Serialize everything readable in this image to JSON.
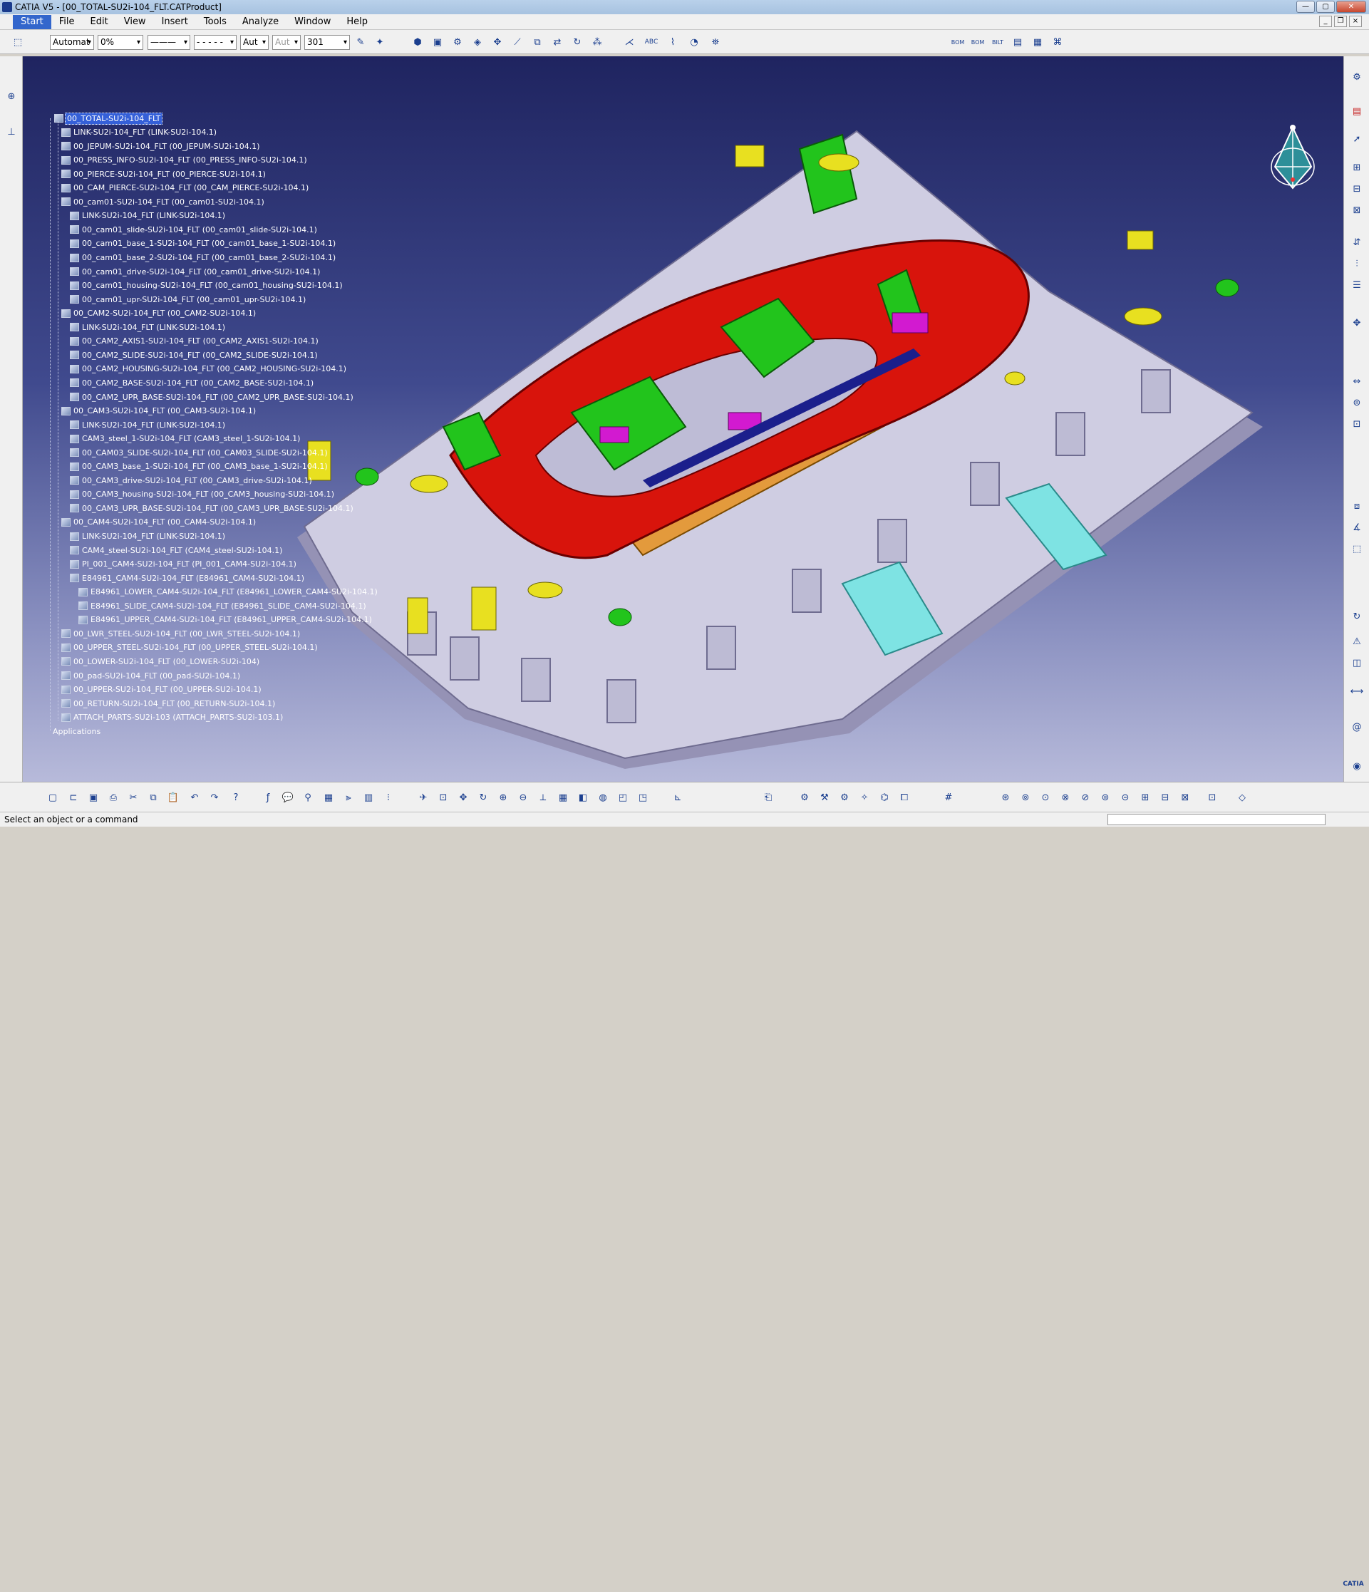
{
  "window": {
    "title": "CATIA V5 - [00_TOTAL-SU2i-104_FLT.CATProduct]",
    "controls": [
      "—",
      "▢",
      "✕"
    ]
  },
  "menu": [
    "Start",
    "File",
    "Edit",
    "View",
    "Insert",
    "Tools",
    "Analyze",
    "Window",
    "Help"
  ],
  "toolbar": {
    "selects": [
      {
        "name": "color-select",
        "value": "Automat"
      },
      {
        "name": "transparency-select",
        "value": "0%"
      },
      {
        "name": "linetype-select",
        "value": "———"
      },
      {
        "name": "linestyle-select",
        "value": "- - - - -"
      },
      {
        "name": "layer-select",
        "value": "Aut"
      },
      {
        "name": "render-select",
        "value": "Aut"
      },
      {
        "name": "weight-select",
        "value": "301"
      }
    ],
    "bom_labels": [
      "BOM",
      "BOM",
      "BILT"
    ]
  },
  "tree": [
    {
      "label": "00_TOTAL-SU2i-104_FLT",
      "level": 0,
      "root": true
    },
    {
      "label": "LINK-SU2i-104_FLT (LINK-SU2i-104.1)",
      "level": 1
    },
    {
      "label": "00_JEPUM-SU2i-104_FLT (00_JEPUM-SU2i-104.1)",
      "level": 1
    },
    {
      "label": "00_PRESS_INFO-SU2i-104_FLT (00_PRESS_INFO-SU2i-104.1)",
      "level": 1
    },
    {
      "label": "00_PIERCE-SU2i-104_FLT (00_PIERCE-SU2i-104.1)",
      "level": 1
    },
    {
      "label": "00_CAM_PIERCE-SU2i-104_FLT (00_CAM_PIERCE-SU2i-104.1)",
      "level": 1
    },
    {
      "label": "00_cam01-SU2i-104_FLT (00_cam01-SU2i-104.1)",
      "level": 1
    },
    {
      "label": "LINK-SU2i-104_FLT (LINK-SU2i-104.1)",
      "level": 2
    },
    {
      "label": "00_cam01_slide-SU2i-104_FLT (00_cam01_slide-SU2i-104.1)",
      "level": 2
    },
    {
      "label": "00_cam01_base_1-SU2i-104_FLT (00_cam01_base_1-SU2i-104.1)",
      "level": 2
    },
    {
      "label": "00_cam01_base_2-SU2i-104_FLT (00_cam01_base_2-SU2i-104.1)",
      "level": 2
    },
    {
      "label": "00_cam01_drive-SU2i-104_FLT (00_cam01_drive-SU2i-104.1)",
      "level": 2
    },
    {
      "label": "00_cam01_housing-SU2i-104_FLT (00_cam01_housing-SU2i-104.1)",
      "level": 2
    },
    {
      "label": "00_cam01_upr-SU2i-104_FLT (00_cam01_upr-SU2i-104.1)",
      "level": 2
    },
    {
      "label": "00_CAM2-SU2i-104_FLT (00_CAM2-SU2i-104.1)",
      "level": 1
    },
    {
      "label": "LINK-SU2i-104_FLT (LINK-SU2i-104.1)",
      "level": 2
    },
    {
      "label": "00_CAM2_AXIS1-SU2i-104_FLT (00_CAM2_AXIS1-SU2i-104.1)",
      "level": 2
    },
    {
      "label": "00_CAM2_SLIDE-SU2i-104_FLT (00_CAM2_SLIDE-SU2i-104.1)",
      "level": 2
    },
    {
      "label": "00_CAM2_HOUSING-SU2i-104_FLT (00_CAM2_HOUSING-SU2i-104.1)",
      "level": 2
    },
    {
      "label": "00_CAM2_BASE-SU2i-104_FLT (00_CAM2_BASE-SU2i-104.1)",
      "level": 2
    },
    {
      "label": "00_CAM2_UPR_BASE-SU2i-104_FLT (00_CAM2_UPR_BASE-SU2i-104.1)",
      "level": 2
    },
    {
      "label": "00_CAM3-SU2i-104_FLT (00_CAM3-SU2i-104.1)",
      "level": 1
    },
    {
      "label": "LINK-SU2i-104_FLT (LINK-SU2i-104.1)",
      "level": 2
    },
    {
      "label": "CAM3_steel_1-SU2i-104_FLT (CAM3_steel_1-SU2i-104.1)",
      "level": 2
    },
    {
      "label": "00_CAM03_SLIDE-SU2i-104_FLT (00_CAM03_SLIDE-SU2i-104.1)",
      "level": 2
    },
    {
      "label": "00_CAM3_base_1-SU2i-104_FLT (00_CAM3_base_1-SU2i-104.1)",
      "level": 2
    },
    {
      "label": "00_CAM3_drive-SU2i-104_FLT (00_CAM3_drive-SU2i-104.1)",
      "level": 2
    },
    {
      "label": "00_CAM3_housing-SU2i-104_FLT (00_CAM3_housing-SU2i-104.1)",
      "level": 2
    },
    {
      "label": "00_CAM3_UPR_BASE-SU2i-104_FLT (00_CAM3_UPR_BASE-SU2i-104.1)",
      "level": 2
    },
    {
      "label": "00_CAM4-SU2i-104_FLT (00_CAM4-SU2i-104.1)",
      "level": 1
    },
    {
      "label": "LINK-SU2i-104_FLT (LINK-SU2i-104.1)",
      "level": 2
    },
    {
      "label": "CAM4_steel-SU2i-104_FLT (CAM4_steel-SU2i-104.1)",
      "level": 2
    },
    {
      "label": "PI_001_CAM4-SU2i-104_FLT (PI_001_CAM4-SU2i-104.1)",
      "level": 2
    },
    {
      "label": "E84961_CAM4-SU2i-104_FLT (E84961_CAM4-SU2i-104.1)",
      "level": 2
    },
    {
      "label": "E84961_LOWER_CAM4-SU2i-104_FLT (E84961_LOWER_CAM4-SU2i-104.1)",
      "level": 3
    },
    {
      "label": "E84961_SLIDE_CAM4-SU2i-104_FLT (E84961_SLIDE_CAM4-SU2i-104.1)",
      "level": 3
    },
    {
      "label": "E84961_UPPER_CAM4-SU2i-104_FLT (E84961_UPPER_CAM4-SU2i-104.1)",
      "level": 3
    },
    {
      "label": "00_LWR_STEEL-SU2i-104_FLT (00_LWR_STEEL-SU2i-104.1)",
      "level": 1
    },
    {
      "label": "00_UPPER_STEEL-SU2i-104_FLT (00_UPPER_STEEL-SU2i-104.1)",
      "level": 1
    },
    {
      "label": "00_LOWER-SU2i-104_FLT (00_LOWER-SU2i-104)",
      "level": 1
    },
    {
      "label": "00_pad-SU2i-104_FLT (00_pad-SU2i-104.1)",
      "level": 1
    },
    {
      "label": "00_UPPER-SU2i-104_FLT (00_UPPER-SU2i-104.1)",
      "level": 1
    },
    {
      "label": "00_RETURN-SU2i-104_FLT (00_RETURN-SU2i-104.1)",
      "level": 1
    },
    {
      "label": "ATTACH_PARTS-SU2i-103 (ATTACH_PARTS-SU2i-103.1)",
      "level": 1
    },
    {
      "label": "Applications",
      "level": 0,
      "apps": true
    }
  ],
  "status": {
    "message": "Select an object or a command"
  },
  "logo": {
    "text": "CATIA"
  },
  "colors": {
    "viewport_top": "#1f2460",
    "viewport_bottom": "#b7bada",
    "part_red": "#d8140c",
    "part_green": "#22c41c",
    "part_yellow": "#e8e020",
    "part_orange": "#d97a10",
    "part_magenta": "#d21ad0",
    "part_cyan": "#4fd6d6",
    "base_grey": "#cfcde2"
  }
}
